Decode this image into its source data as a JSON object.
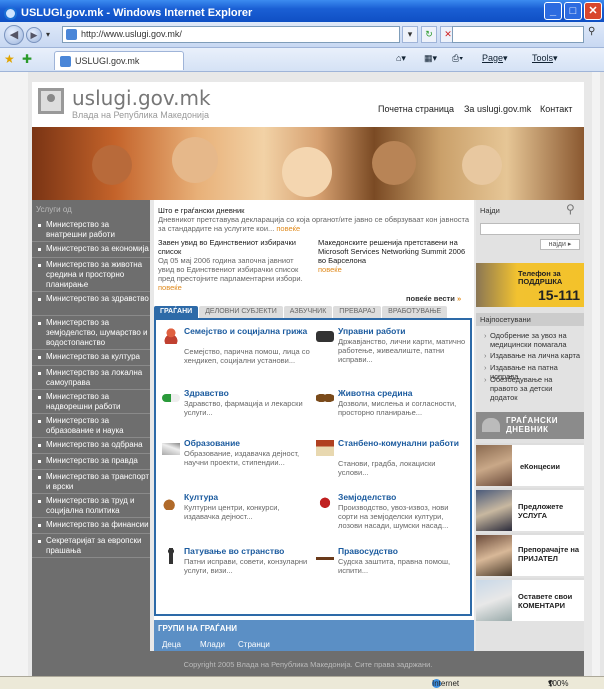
{
  "browser": {
    "title": "USLUGI.gov.mk - Windows Internet Explorer",
    "url": "http://www.uslugi.gov.mk/",
    "tab_label": "USLUGI.gov.mk",
    "page_menu": "Page",
    "tools_menu": "Tools",
    "status_zone": "Internet",
    "zoom": "100%"
  },
  "site": {
    "logo": "uslugi.gov.mk",
    "logo_sub": "Влада на Република Македонија",
    "nav": [
      "Почетна страница",
      "За uslugi.gov.mk",
      "Контакт"
    ]
  },
  "left": {
    "header": "Услуги од",
    "items": [
      "Министерство за внатрешни работи",
      "Министерство за економија",
      "Министерство за животна средина и просторно планирање",
      "Министерство за здравство",
      "Министерство за земјоделство, шумарство и водостопанство",
      "Министерство за култура",
      "Министерство за локална самоуправа",
      "Министерство за надворешни работи",
      "Министерство за образование и наука",
      "Министерство за одбрана",
      "Министерство за правда",
      "Министерство за транспорт и врски",
      "Министерство за труд и социјална политика",
      "Министерство за финансии",
      "Секретаријат за европски прашања"
    ]
  },
  "news": {
    "main_title": "Што е граѓански дневник",
    "main_text": "Дневникот претставува декларација со која органот/ите јавно се обврзуваат кон јавноста за стандардите на услугите кои...",
    "more": "повеќе",
    "item1_title": "Завен увид во Единствениот избирачки список",
    "item1_text": "Од 05 мај 2006 година започна јавниот увид во Единствениот избирачки список пред престојните парламентарни избори.",
    "item2_title": "Македонските решенија претставени на Microsoft Services Networking Summit 2006 во Барселона",
    "more_news": "повеќе вести"
  },
  "tabs": [
    "ГРАЃАНИ",
    "ДЕЛОВНИ СУБЈЕКТИ",
    "АЗБУЧНИК",
    "ПРЕВАРАЈ",
    "ВРАБОТУВАЊЕ"
  ],
  "categories": [
    {
      "name": "Семејство и социјална грижа",
      "desc": "Семејство, парична помош, лица со хендикеп, социјални установи..."
    },
    {
      "name": "Управни работи",
      "desc": "Државјанство, лични карти, матично работење, живеалиште, патни исправи..."
    },
    {
      "name": "Здравство",
      "desc": "Здравство, фармација и лекарски услуги..."
    },
    {
      "name": "Животна средина",
      "desc": "Дозволи, мислења и согласности, просторно планирање..."
    },
    {
      "name": "Образование",
      "desc": "Образование, издавачка дејност, научни проекти, стипендии..."
    },
    {
      "name": "Станбено-комунални работи",
      "desc": "Станови, градба, локациски услови..."
    },
    {
      "name": "Култура",
      "desc": "Културни центри, конкурси, издавачка дејност..."
    },
    {
      "name": "Земјоделство",
      "desc": "Производство, увоз-извоз, нови сорти на земјоделски култури, лозови насади, шумски насад..."
    },
    {
      "name": "Патување во странство",
      "desc": "Патни исправи, совети, конзуларни услуги, визи..."
    },
    {
      "name": "Правосудство",
      "desc": "Судска заштита, правна помош, испити..."
    }
  ],
  "groups": {
    "header": "ГРУПИ НА ГРАЃАНИ",
    "links": [
      "Деца",
      "Млади",
      "Странци"
    ]
  },
  "right": {
    "search_label": "Најди",
    "search_button": "најди",
    "phone_text": "Телефон за ПОДДРШКА",
    "phone_number": "15-111",
    "most_visited_header": "Најпосетувани",
    "most_visited": [
      "Одобрение за увоз на медицински помагала",
      "Издавање на лична карта",
      "Издавање на патна исправа",
      "Обезбедување на правото за детски додаток"
    ],
    "diary_banner": "ГРАЃАНСКИ ДНЕВНИК",
    "promos": [
      "еКонцесии",
      "Предложете УСЛУГА",
      "Препорачајте на ПРИЈАТЕЛ",
      "Оставете свои КОМЕНТАРИ"
    ]
  },
  "footer": "Copyright 2005 Влада на Република Македонија. Сите права задржани.",
  "colors": {
    "accent": "#2d6aa8",
    "titlebar": "#1a5fd4",
    "sidebar": "#6e6e6e",
    "phone_yellow": "#f3c22a"
  }
}
